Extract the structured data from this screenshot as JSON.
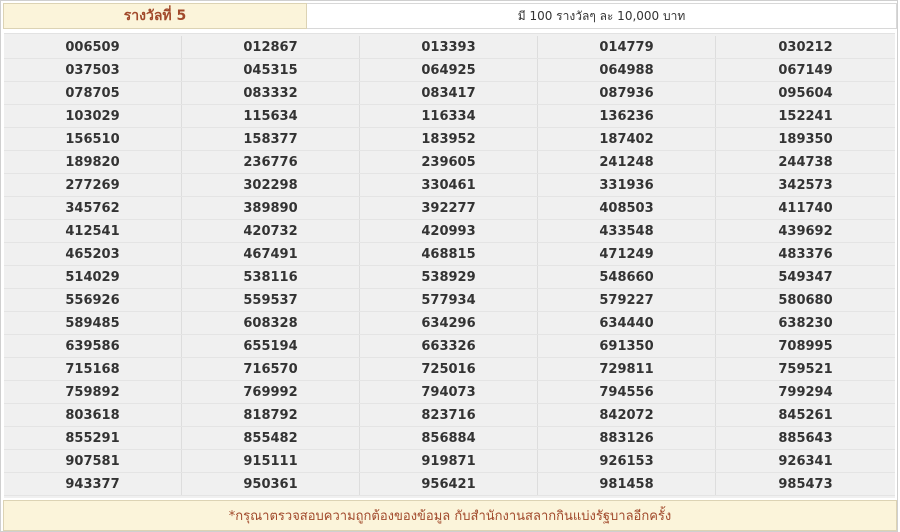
{
  "header": {
    "prize_title": "รางวัลที่ 5",
    "prize_description": "มี 100 รางวัลๆ ละ 10,000 บาท"
  },
  "numbers": [
    [
      "006509",
      "012867",
      "013393",
      "014779",
      "030212"
    ],
    [
      "037503",
      "045315",
      "064925",
      "064988",
      "067149"
    ],
    [
      "078705",
      "083332",
      "083417",
      "087936",
      "095604"
    ],
    [
      "103029",
      "115634",
      "116334",
      "136236",
      "152241"
    ],
    [
      "156510",
      "158377",
      "183952",
      "187402",
      "189350"
    ],
    [
      "189820",
      "236776",
      "239605",
      "241248",
      "244738"
    ],
    [
      "277269",
      "302298",
      "330461",
      "331936",
      "342573"
    ],
    [
      "345762",
      "389890",
      "392277",
      "408503",
      "411740"
    ],
    [
      "412541",
      "420732",
      "420993",
      "433548",
      "439692"
    ],
    [
      "465203",
      "467491",
      "468815",
      "471249",
      "483376"
    ],
    [
      "514029",
      "538116",
      "538929",
      "548660",
      "549347"
    ],
    [
      "556926",
      "559537",
      "577934",
      "579227",
      "580680"
    ],
    [
      "589485",
      "608328",
      "634296",
      "634440",
      "638230"
    ],
    [
      "639586",
      "655194",
      "663326",
      "691350",
      "708995"
    ],
    [
      "715168",
      "716570",
      "725016",
      "729811",
      "759521"
    ],
    [
      "759892",
      "769992",
      "794073",
      "794556",
      "799294"
    ],
    [
      "803618",
      "818792",
      "823716",
      "842072",
      "845261"
    ],
    [
      "855291",
      "855482",
      "856884",
      "883126",
      "885643"
    ],
    [
      "907581",
      "915111",
      "919871",
      "926153",
      "926341"
    ],
    [
      "943377",
      "950361",
      "956421",
      "981458",
      "985473"
    ]
  ],
  "footer": {
    "note": "*กรุณาตรวจสอบความถูกต้องของข้อมูล กับสำนักงานสลากกินแบ่งรัฐบาลอีกครั้ง"
  },
  "colors": {
    "accent_text": "#a1492b",
    "header_bg": "#fbf4da",
    "grid_bg": "#f0f0f0"
  }
}
